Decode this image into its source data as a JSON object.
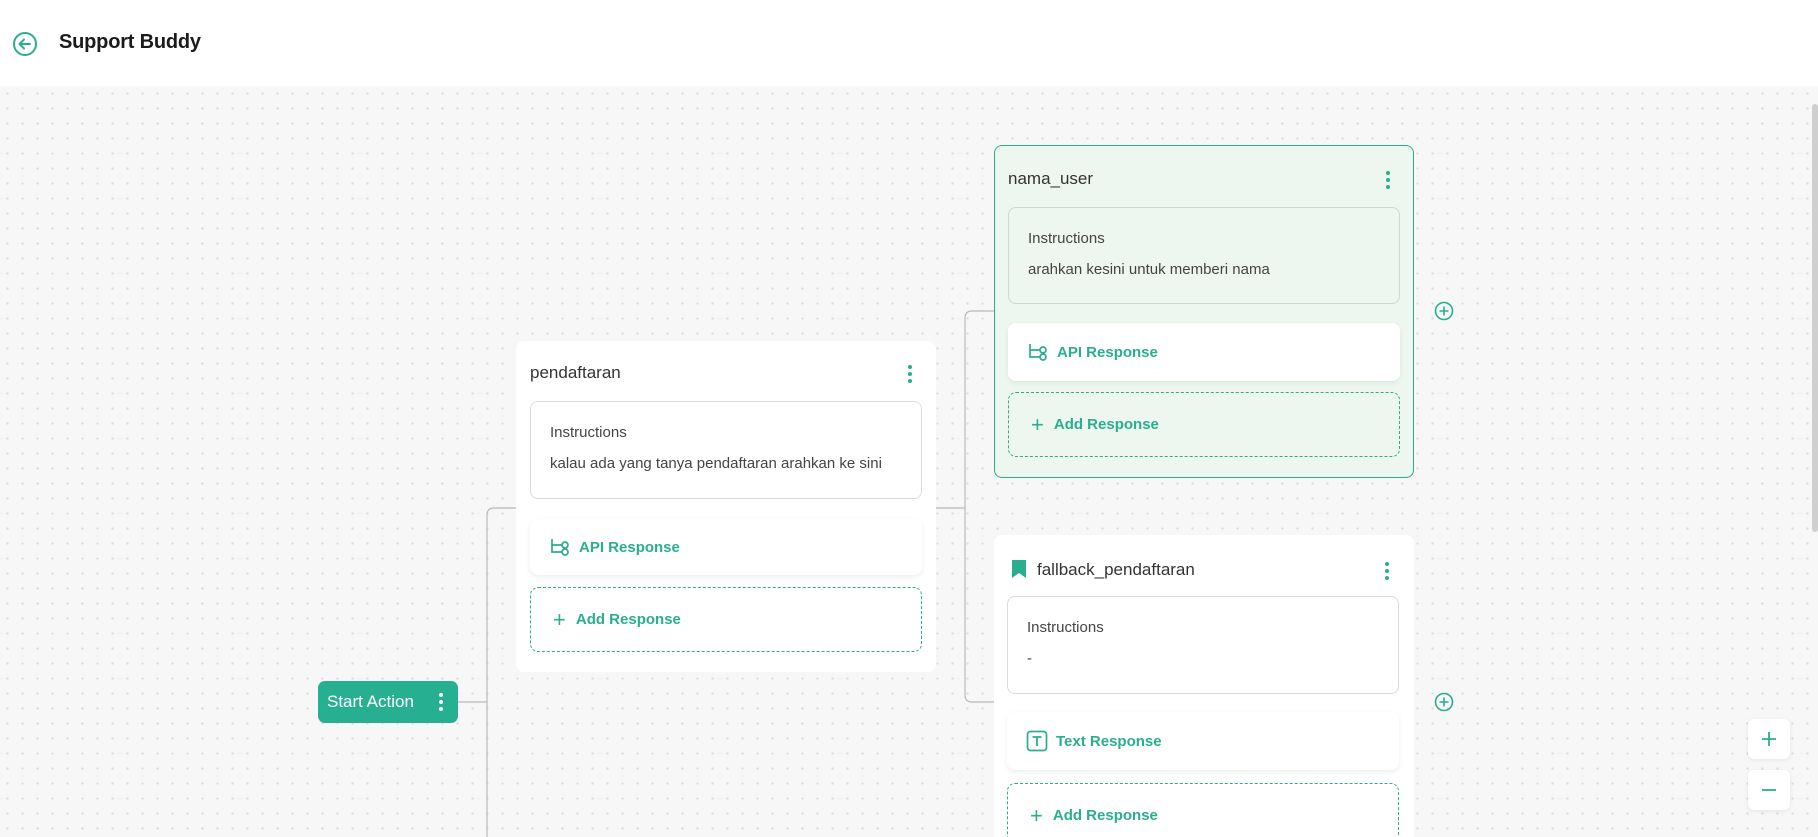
{
  "header": {
    "title": "Support Buddy",
    "back_icon": "arrow-left-circle-icon"
  },
  "start_node": {
    "label": "Start Action"
  },
  "nodes": [
    {
      "title": "pendaftaran",
      "instructions_label": "Instructions",
      "instructions_text": "kalau ada yang tanya pendaftaran arahkan ke sini",
      "responses": [
        {
          "label": "API Response",
          "icon": "api-flow-icon"
        }
      ],
      "add_response_label": "Add Response"
    },
    {
      "title": "nama_user",
      "instructions_label": "Instructions",
      "instructions_text": "arahkan kesini untuk memberi nama",
      "responses": [
        {
          "label": "API Response",
          "icon": "api-flow-icon"
        }
      ],
      "add_response_label": "Add Response",
      "selected": true
    },
    {
      "title": "fallback_pendaftaran",
      "title_icon": "bookmark-icon",
      "instructions_label": "Instructions",
      "instructions_text": "-",
      "responses": [
        {
          "label": "Text Response",
          "icon": "text-box-icon"
        }
      ],
      "add_response_label": "Add Response"
    }
  ],
  "zoom": {
    "in_icon": "plus-icon",
    "out_icon": "minus-icon"
  },
  "colors": {
    "accent": "#2aae8e",
    "start_node": "#26b091",
    "selected_bg": "#eef7ef"
  }
}
